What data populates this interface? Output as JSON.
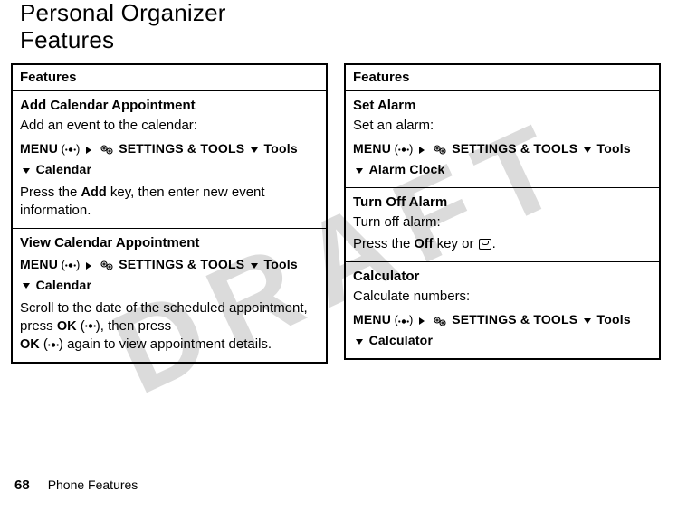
{
  "watermark": "DRAFT",
  "title": "Personal Organizer Features",
  "left": {
    "header": "Features",
    "rows": [
      {
        "title": "Add Calendar Appointment",
        "desc": "Add an event to the calendar:",
        "nav": {
          "menu": "MENU",
          "settings": "SETTINGS & TOOLS",
          "tools": "Tools",
          "leaf": "Calendar"
        },
        "note_pre": "Press the ",
        "note_key": "Add",
        "note_post": " key, then enter new event information."
      },
      {
        "title": "View Calendar Appointment",
        "desc": "",
        "nav": {
          "menu": "MENU",
          "settings": "SETTINGS & TOOLS",
          "tools": "Tools",
          "leaf": "Calendar"
        },
        "note_pre": "Scroll to the date of the scheduled appointment, press ",
        "note_key": "OK",
        "note_mid": ", then press ",
        "note_key2": "OK",
        "note_post2": " again to view appointment details."
      }
    ]
  },
  "right": {
    "header": "Features",
    "rows": [
      {
        "title": "Set Alarm",
        "desc": "Set an alarm:",
        "nav": {
          "menu": "MENU",
          "settings": "SETTINGS & TOOLS",
          "tools": "Tools",
          "leaf": "Alarm Clock"
        }
      },
      {
        "title": "Turn Off Alarm",
        "desc": "Turn off alarm:",
        "note_pre": "Press the ",
        "note_key": "Off",
        "note_mid": " key or ",
        "endkey": true,
        "note_post2": "."
      },
      {
        "title": "Calculator",
        "desc": "Calculate numbers:",
        "nav": {
          "menu": "MENU",
          "settings": "SETTINGS & TOOLS",
          "tools": "Tools",
          "leaf": "Calculator"
        }
      }
    ]
  },
  "paren_open": "(",
  "paren_close": ")",
  "footer": {
    "page": "68",
    "title": "Phone Features"
  }
}
